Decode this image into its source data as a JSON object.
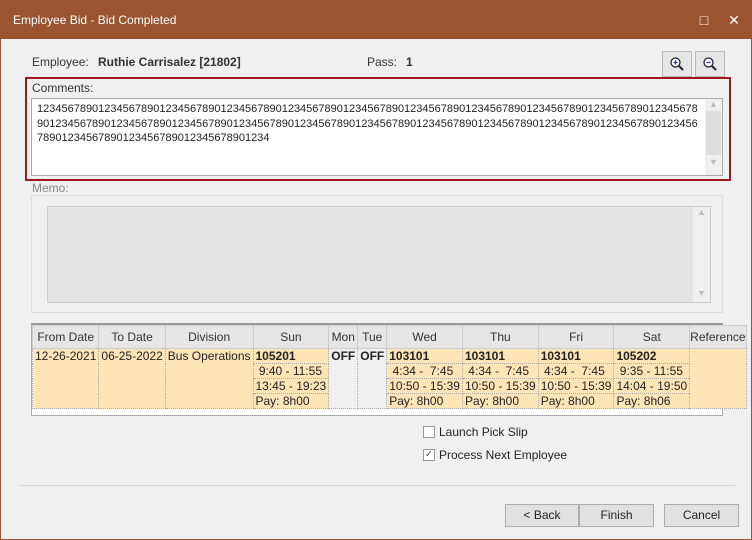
{
  "window": {
    "title": "Employee Bid - Bid Completed",
    "maximize_icon": "□",
    "close_icon": "✕"
  },
  "header": {
    "employee_label": "Employee:",
    "employee_value": "Ruthie Carrisalez [21802]",
    "pass_label": "Pass:",
    "pass_value": "1",
    "zoom_in_icon": "zoom-in",
    "zoom_out_icon": "zoom-out"
  },
  "comments": {
    "label": "Comments:",
    "value": "12345678901234567890123456789012345678901234567890123456789012345678901234567890123456789012345678901234567890123456789012345678901234567890123456789012345678901234567890123456789012345678901234567890123456789012345678901234567890123456789012345678901234"
  },
  "memo": {
    "label": "Memo:",
    "value": ""
  },
  "grid": {
    "columns": [
      "From Date",
      "To Date",
      "Division",
      "Sun",
      "Mon",
      "Tue",
      "Wed",
      "Thu",
      "Fri",
      "Sat",
      "Reference"
    ],
    "row": {
      "from_date": "12-26-2021",
      "to_date": "06-25-2022",
      "division": "Bus Operations",
      "reference": "",
      "days": [
        {
          "day": "Sun",
          "off": false,
          "lines": [
            "105201",
            " 9:40 - 11:55",
            "13:45 - 19:23",
            "Pay: 8h00"
          ]
        },
        {
          "day": "Mon",
          "off": true,
          "lines": [
            "OFF"
          ]
        },
        {
          "day": "Tue",
          "off": true,
          "lines": [
            "OFF"
          ]
        },
        {
          "day": "Wed",
          "off": false,
          "lines": [
            "103101",
            " 4:34 -  7:45",
            "10:50 - 15:39",
            "Pay: 8h00"
          ]
        },
        {
          "day": "Thu",
          "off": false,
          "lines": [
            "103101",
            " 4:34 -  7:45",
            "10:50 - 15:39",
            "Pay: 8h00"
          ]
        },
        {
          "day": "Fri",
          "off": false,
          "lines": [
            "103101",
            " 4:34 -  7:45",
            "10:50 - 15:39",
            "Pay: 8h00"
          ]
        },
        {
          "day": "Sat",
          "off": false,
          "lines": [
            "105202",
            " 9:35 - 11:55",
            "14:04 - 19:50",
            "Pay: 8h06"
          ]
        }
      ]
    }
  },
  "options": {
    "launch_pick_slip": {
      "label": "Launch Pick Slip",
      "checked": false
    },
    "process_next": {
      "label": "Process Next Employee",
      "checked": true
    }
  },
  "buttons": {
    "back": "< Back",
    "finish": "Finish",
    "cancel": "Cancel"
  }
}
